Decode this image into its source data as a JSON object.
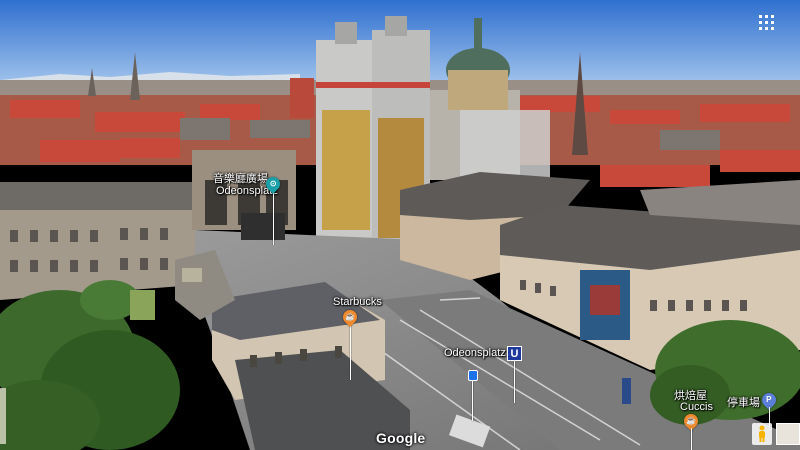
{
  "map": {
    "view": "3D satellite",
    "attribution_logo": "Google"
  },
  "labels": {
    "odeonsplatz_area_cjk": "音樂廳廣場",
    "odeonsplatz_area": "Odeonsplatz",
    "starbucks": "Starbucks",
    "ubahn_station": "Odeonsplatz",
    "ubahn_symbol": "U",
    "cafe_cjk": "烘焙屋",
    "cafe": "Cuccis",
    "parking_cjk": "停車場",
    "parking_symbol": "P"
  },
  "colors": {
    "sky": "#4f8fd8",
    "roof_red": "#c0503a",
    "road": "#8d8d8d",
    "pin_teal": "#1aa0a8",
    "pin_orange": "#f08a2c",
    "pin_parking": "#5b7fd6",
    "ubahn_blue": "#1f3a9c",
    "trees": "#3d6a2c"
  },
  "icons": [
    "apps-grid-icon",
    "pegman-icon",
    "transit-icon",
    "cafe-icon",
    "parking-icon",
    "tram-stop-icon"
  ]
}
